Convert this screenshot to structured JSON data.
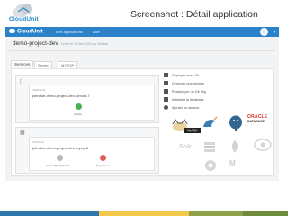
{
  "brand": {
    "logo_text": "CloudUnit"
  },
  "slide": {
    "title": "Screenshot : Détail application"
  },
  "app_header": {
    "logo": "CloudUnit",
    "nav": [
      "Mes applications",
      "Aide"
    ],
    "avatar_icon": "user-avatar-icon"
  },
  "application": {
    "name": "demo-project-dev",
    "subtitle": "Créée le 12 mai 2015 par Nicolas"
  },
  "tabs": [
    {
      "label": "Services"
    },
    {
      "label": "Server Logs"
    },
    {
      "label": "MYTOP Logs"
    }
  ],
  "server": {
    "label": "SERVEUR",
    "name": "johndoe-demo-project-dev-tomcat-7",
    "action": "Arrêter",
    "icon": "server-icon"
  },
  "module": {
    "label": "MODULE",
    "name": "johndoe-demo-project-dev-mysql-5",
    "actions": [
      "Accès PhpMyAdmin",
      "Supprimer"
    ],
    "icon": "module-icon"
  },
  "actions": [
    {
      "label": "Déployer avec Git",
      "icon": "git-icon"
    },
    {
      "label": "Déployer une archive",
      "icon": "archive-icon"
    },
    {
      "label": "Redéployer un Git Tag",
      "icon": "tag-icon"
    },
    {
      "label": "Initialiser la database",
      "icon": "database-icon"
    },
    {
      "label": "Ajouter un service",
      "icon": "add-icon"
    }
  ],
  "tooltip": {
    "text": "MySQL"
  },
  "gallery": {
    "oracle": {
      "line1": "ORACLE",
      "line2": "DATABASE"
    },
    "solr": "Solr"
  },
  "colors": {
    "brand_blue": "#2b82c9",
    "header_text": "#333333",
    "band": [
      "#2f76ad",
      "#f2c94c",
      "#8ea04a",
      "#6f8c3b"
    ]
  }
}
